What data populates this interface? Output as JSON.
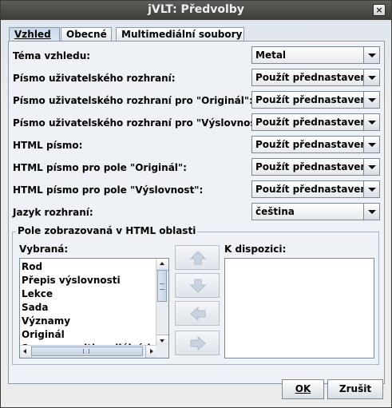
{
  "window": {
    "title": "jVLT: Předvolby",
    "close_glyph": "×"
  },
  "tabs": [
    {
      "label": "Vzhled",
      "selected": true
    },
    {
      "label": "Obecné",
      "selected": false
    },
    {
      "label": "Multimediální soubory",
      "selected": false
    }
  ],
  "settings": [
    {
      "label": "Téma vzhledu:",
      "value": "Metal"
    },
    {
      "label": "Písmo uživatelského rozhraní:",
      "value": "Použít přednastavené"
    },
    {
      "label": "Písmo uživatelského rozhraní pro \"Originál\":",
      "value": "Použít přednastavené"
    },
    {
      "label": "Písmo uživatelského rozhraní pro \"Výslovnost\":",
      "value": "Použít přednastavené"
    },
    {
      "label": "HTML písmo:",
      "value": "Použít přednastavené"
    },
    {
      "label": "HTML písmo pro pole \"Originál\":",
      "value": "Použít přednastavené"
    },
    {
      "label": "HTML písmo pro pole \"Výslovnost\":",
      "value": "Použít přednastavené"
    },
    {
      "label": "Jazyk rozhraní:",
      "value": "čeština"
    }
  ],
  "fields_group": {
    "title": "Pole zobrazovaná v HTML oblasti",
    "selected_label": "Vybraná:",
    "available_label": "K dispozici:",
    "selected_items": [
      "Rod",
      "Přepis výslovnosti",
      "Lekce",
      "Sada",
      "Významy",
      "Originál",
      "Seznam multimediálních so"
    ],
    "available_items": []
  },
  "buttons": {
    "ok": "OK",
    "cancel": "Zrušit"
  },
  "colors": {
    "titlebar": "#3d3c38",
    "tab_selected": "#c8d8ec",
    "arrow_disabled": "#c9d4e0"
  }
}
